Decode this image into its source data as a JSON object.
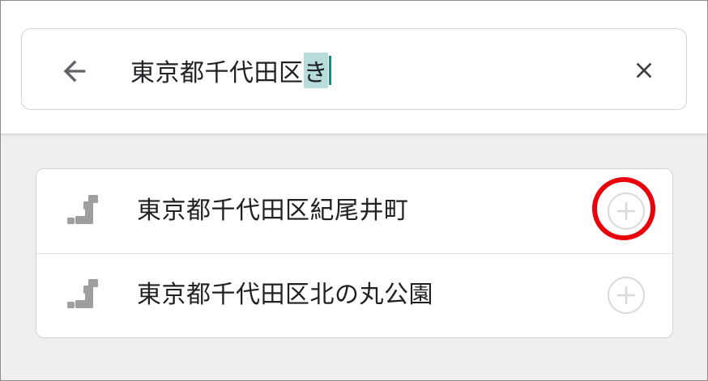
{
  "search": {
    "query_committed": "東京都千代田区",
    "query_composing": "き"
  },
  "icons": {
    "back": "arrow-back-icon",
    "clear": "close-icon",
    "result": "japan-map-icon",
    "add": "plus-circle-icon"
  },
  "results": [
    {
      "label": "東京都千代田区紀尾井町"
    },
    {
      "label": "東京都千代田区北の丸公園"
    }
  ],
  "colors": {
    "highlight_ring": "#e8000b",
    "caret": "#1a8a80",
    "composing_bg": "#b6ddd9",
    "icon_gray": "#9e9e9e"
  }
}
